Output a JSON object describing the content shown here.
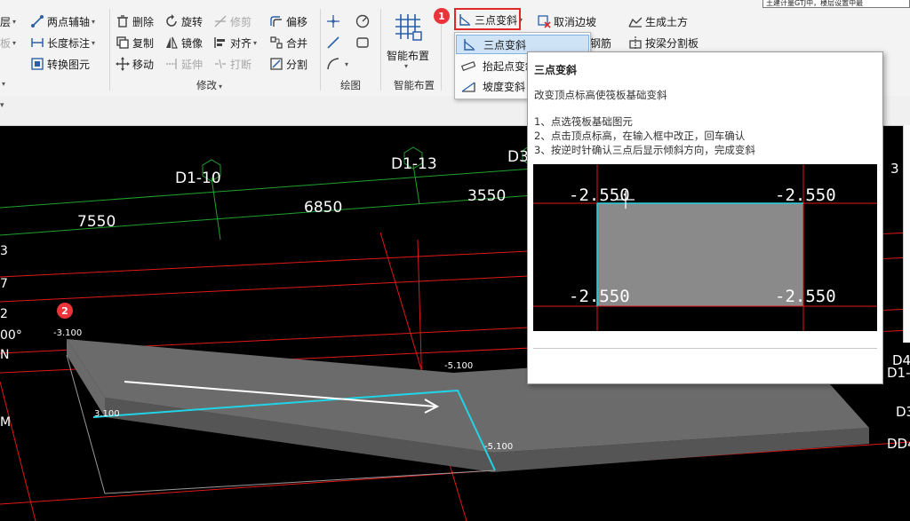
{
  "topright_text": "土建计量GTJ中，楼层设置中最",
  "ribbon": {
    "tools": [
      {
        "key": "t_floor",
        "label": "层",
        "icon": "floor-icon",
        "caret": true
      },
      {
        "key": "t_plate",
        "label": "板",
        "icon": "plate-icon",
        "caret": true,
        "disabled": true
      },
      {
        "key": "t_twopoint",
        "label": "两点辅轴",
        "icon": "two-point-axis-icon",
        "caret": true
      },
      {
        "key": "t_length",
        "label": "长度标注",
        "icon": "length-dimension-icon",
        "caret": true
      },
      {
        "key": "t_convert",
        "label": "转换图元",
        "icon": "convert-element-icon"
      },
      {
        "key": "t_delete",
        "label": "删除",
        "icon": "delete-icon"
      },
      {
        "key": "t_rotate",
        "label": "旋转",
        "icon": "rotate-icon"
      },
      {
        "key": "t_trim",
        "label": "修剪",
        "icon": "trim-icon",
        "disabled": true
      },
      {
        "key": "t_offset",
        "label": "偏移",
        "icon": "offset-icon"
      },
      {
        "key": "t_copy",
        "label": "复制",
        "icon": "copy-icon"
      },
      {
        "key": "t_mirror",
        "label": "镜像",
        "icon": "mirror-icon"
      },
      {
        "key": "t_align",
        "label": "对齐",
        "icon": "align-icon",
        "caret": true
      },
      {
        "key": "t_merge",
        "label": "合并",
        "icon": "merge-icon"
      },
      {
        "key": "t_move",
        "label": "移动",
        "icon": "move-icon"
      },
      {
        "key": "t_extend",
        "label": "延伸",
        "icon": "extend-icon",
        "disabled": true
      },
      {
        "key": "t_break",
        "label": "打断",
        "icon": "break-icon",
        "disabled": true
      },
      {
        "key": "t_split",
        "label": "分割",
        "icon": "split-icon"
      },
      {
        "key": "t_three",
        "label": "三点变斜",
        "icon": "three-point-slope-icon",
        "caret": true
      },
      {
        "key": "t_cancel_edge",
        "label": "取消边坡",
        "icon": "cancel-slope-icon"
      },
      {
        "key": "t_earthwork",
        "label": "生成土方",
        "icon": "earthwork-icon"
      },
      {
        "key": "t_rebar",
        "label": "钢筋",
        "icon": "rebar-icon"
      },
      {
        "key": "t_beamsplit",
        "label": "按梁分割板",
        "icon": "beam-split-icon"
      }
    ],
    "smart_layout_label": "智能布置",
    "groups": {
      "modify": "修改",
      "draw": "绘图",
      "smart": "智能布置"
    }
  },
  "dropdown": {
    "items": [
      {
        "label": "三点变斜",
        "icon": "three-point-slope-icon",
        "selected": true
      },
      {
        "label": "抬起点变斜",
        "icon": "raise-point-slope-icon"
      },
      {
        "label": "坡度变斜",
        "icon": "slope-angle-icon"
      }
    ]
  },
  "tooltip": {
    "title": "三点变斜",
    "desc": "改变顶点标高使筏板基础变斜",
    "steps": [
      "1、点选筏板基础图元",
      "2、点击顶点标高，在输入框中改正，回车确认",
      "3、按逆时针确认三点后显示倾斜方向，完成变斜"
    ],
    "demo_values": [
      "-2.550",
      "-2.550",
      "-2.550",
      "-2.550"
    ]
  },
  "badges": {
    "one": "1",
    "two": "2"
  },
  "canvas": {
    "axes": [
      {
        "key": "a1",
        "label": "D1-10"
      },
      {
        "key": "a2",
        "label": "D1-13"
      },
      {
        "key": "a3",
        "label": "D3"
      },
      {
        "key": "a4",
        "label": "3"
      },
      {
        "key": "a5",
        "label": "D4"
      },
      {
        "key": "a6",
        "label": "D1-"
      },
      {
        "key": "a7",
        "label": "D3"
      },
      {
        "key": "a8",
        "label": "DD4"
      }
    ],
    "dims": [
      {
        "key": "d1",
        "label": "7550"
      },
      {
        "key": "d2",
        "label": "6850"
      },
      {
        "key": "d3",
        "label": "3550"
      }
    ],
    "elevations": [
      {
        "key": "e1",
        "label": "-3.100"
      },
      {
        "key": "e2",
        "label": "-5.100"
      },
      {
        "key": "e3",
        "label": "3.100"
      },
      {
        "key": "e4",
        "label": "-5.100"
      }
    ],
    "left_labels": [
      "3",
      "7",
      "2",
      "00°",
      "N",
      "M"
    ]
  }
}
